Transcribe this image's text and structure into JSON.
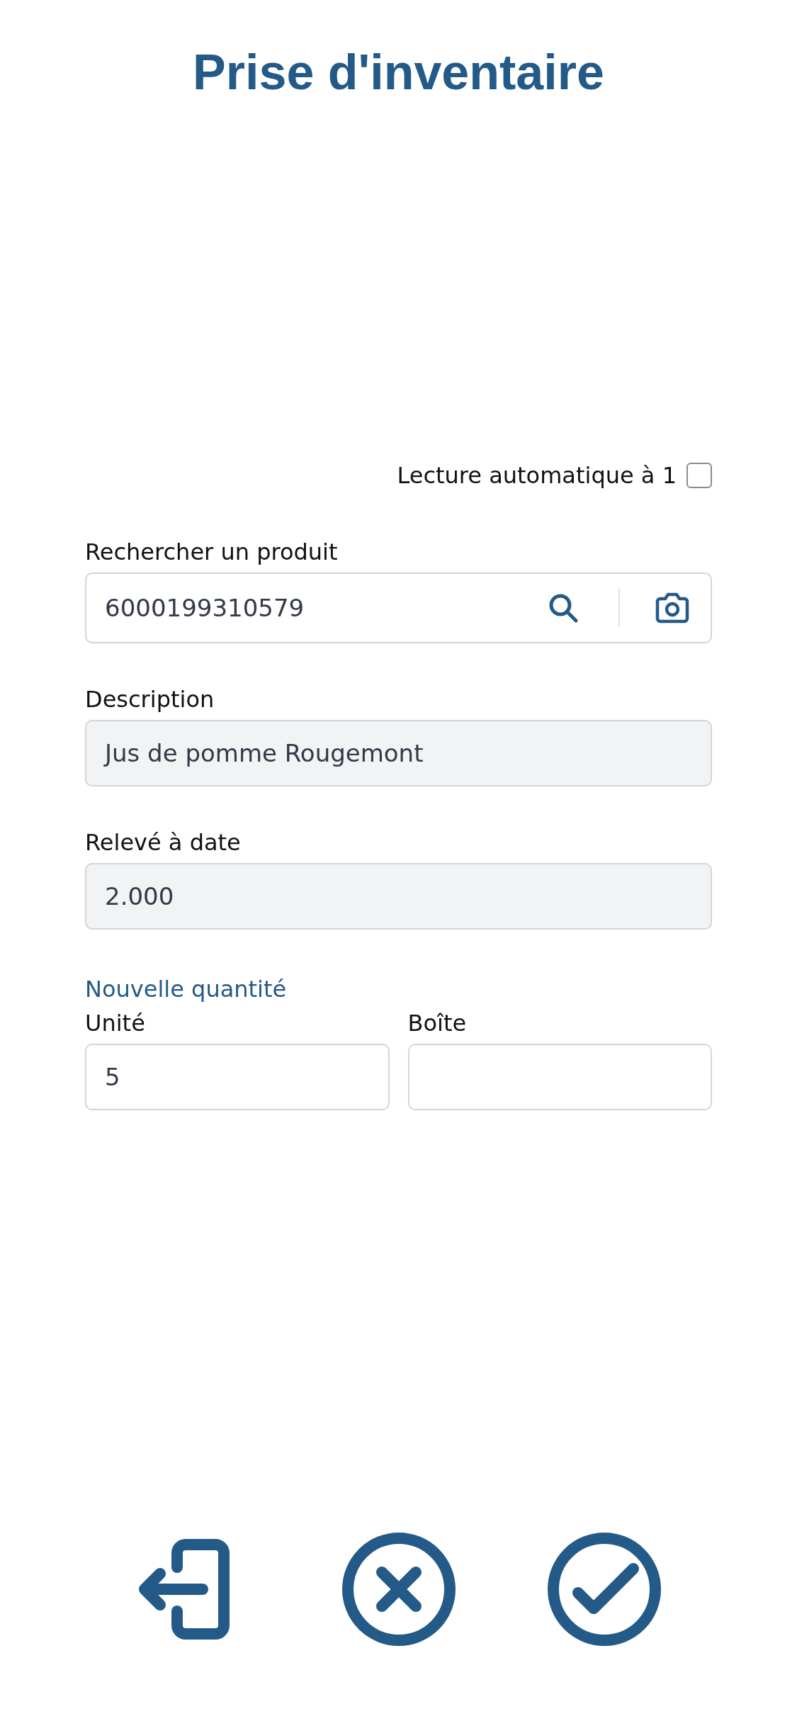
{
  "title": "Prise d'inventaire",
  "auto_read": {
    "label": "Lecture automatique à 1",
    "checked": false
  },
  "search": {
    "label": "Rechercher un produit",
    "value": "6000199310579"
  },
  "fields": [
    {
      "label": "Description",
      "value": "Jus de pomme Rougemont",
      "disabled": true
    },
    {
      "label": "Relevé à date",
      "value": "2.000",
      "disabled": true
    }
  ],
  "new_quantity": {
    "heading": "Nouvelle quantité",
    "fields": [
      {
        "label": "Unité",
        "value": "5"
      },
      {
        "label": "Boîte"
      }
    ]
  },
  "actions": [
    {
      "kind": "exit"
    },
    {
      "kind": "cancel"
    },
    {
      "kind": "confirm"
    }
  ]
}
